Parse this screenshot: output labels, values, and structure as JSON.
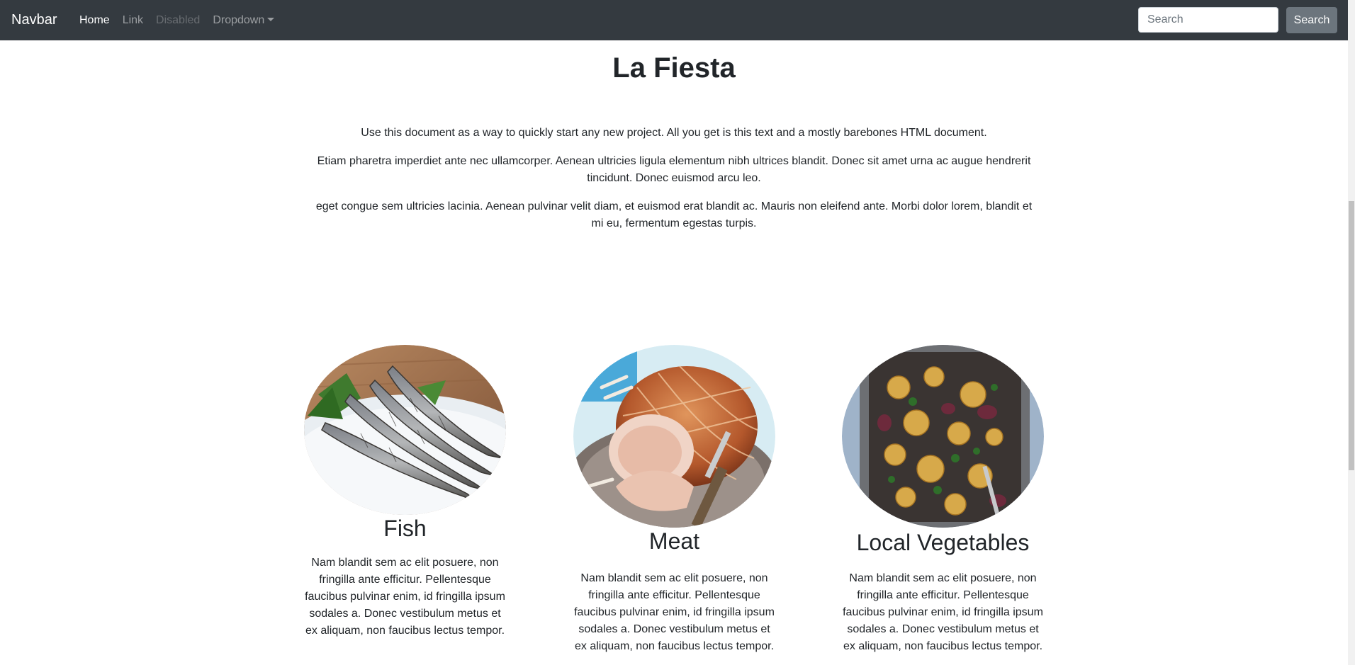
{
  "navbar": {
    "brand": "Navbar",
    "links": [
      {
        "label": "Home",
        "state": "active"
      },
      {
        "label": "Link",
        "state": "normal"
      },
      {
        "label": "Disabled",
        "state": "disabled"
      },
      {
        "label": "Dropdown",
        "state": "dropdown"
      }
    ],
    "search": {
      "placeholder": "Search",
      "value": "",
      "button_label": "Search"
    },
    "colors": {
      "background": "#343a40",
      "button": "#6c757d"
    }
  },
  "main": {
    "title": "La Fiesta",
    "paragraphs": [
      "Use this document as a way to quickly start any new project. All you get is this text and a mostly barebones HTML document.",
      "Etiam pharetra imperdiet ante nec ullamcorper. Aenean ultricies ligula elementum nibh ultrices blandit. Donec sit amet urna ac augue hendrerit tincidunt. Donec euismod arcu leo.",
      "eget congue sem ultricies lacinia. Aenean pulvinar velit diam, et euismod erat blandit ac. Mauris non eleifend ante. Morbi dolor lorem, blandit et mi eu, fermentum egestas turpis."
    ]
  },
  "features": [
    {
      "title": "Fish",
      "image_icon": "grilled-sardines-photo",
      "text": "Nam blandit sem ac elit posuere, non fringilla ante efficitur. Pellentesque faucibus pulvinar enim, id fringilla ipsum sodales a. Donec vestibulum metus et ex aliquam, non faucibus lectus tempor."
    },
    {
      "title": "Meat",
      "image_icon": "roast-pork-photo",
      "text": "Nam blandit sem ac elit posuere, non fringilla ante efficitur. Pellentesque faucibus pulvinar enim, id fringilla ipsum sodales a. Donec vestibulum metus et ex aliquam, non faucibus lectus tempor."
    },
    {
      "title": "Local Vegetables",
      "image_icon": "roasted-vegetables-photo",
      "text": "Nam blandit sem ac elit posuere, non fringilla ante efficitur. Pellentesque faucibus pulvinar enim, id fringilla ipsum sodales a. Donec vestibulum metus et ex aliquam, non faucibus lectus tempor."
    }
  ]
}
